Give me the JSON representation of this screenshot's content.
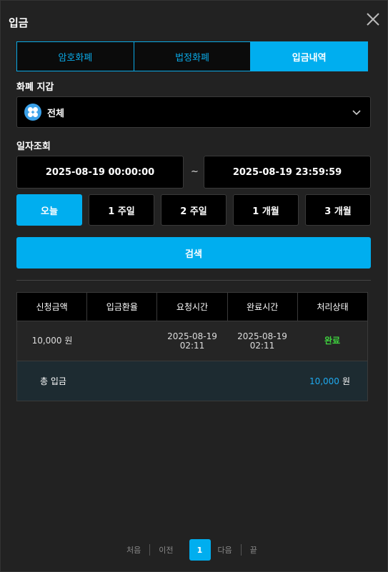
{
  "title": "입금",
  "tabs": [
    {
      "label": "암호화폐",
      "active": false
    },
    {
      "label": "법정화폐",
      "active": false
    },
    {
      "label": "입금내역",
      "active": true
    }
  ],
  "wallet": {
    "label": "화폐 지갑",
    "selected": "전체"
  },
  "dates": {
    "label": "일자조회",
    "from": "2025-08-19 00:00:00",
    "separator": "~",
    "to": "2025-08-19 23:59:59"
  },
  "periods": [
    "오늘",
    "1 주일",
    "2 주일",
    "1 개월",
    "3 개월"
  ],
  "search_label": "검색",
  "table": {
    "headers": [
      "신청금액",
      "입금환율",
      "요청시간",
      "완료시간",
      "처리상태"
    ],
    "rows": [
      {
        "amount": "10,000 원",
        "rate": "",
        "requested_date": "2025-08-19",
        "requested_time": "02:11",
        "completed_date": "2025-08-19",
        "completed_time": "02:11",
        "status": "완료"
      }
    ],
    "total_label": "총 입금",
    "total_value": "10,000",
    "total_unit": "원"
  },
  "pager": {
    "first": "처음",
    "prev": "이전",
    "current": "1",
    "next": "다음",
    "last": "끝"
  },
  "colors": {
    "accent": "#00aeef",
    "status_done": "#3ed43e"
  }
}
